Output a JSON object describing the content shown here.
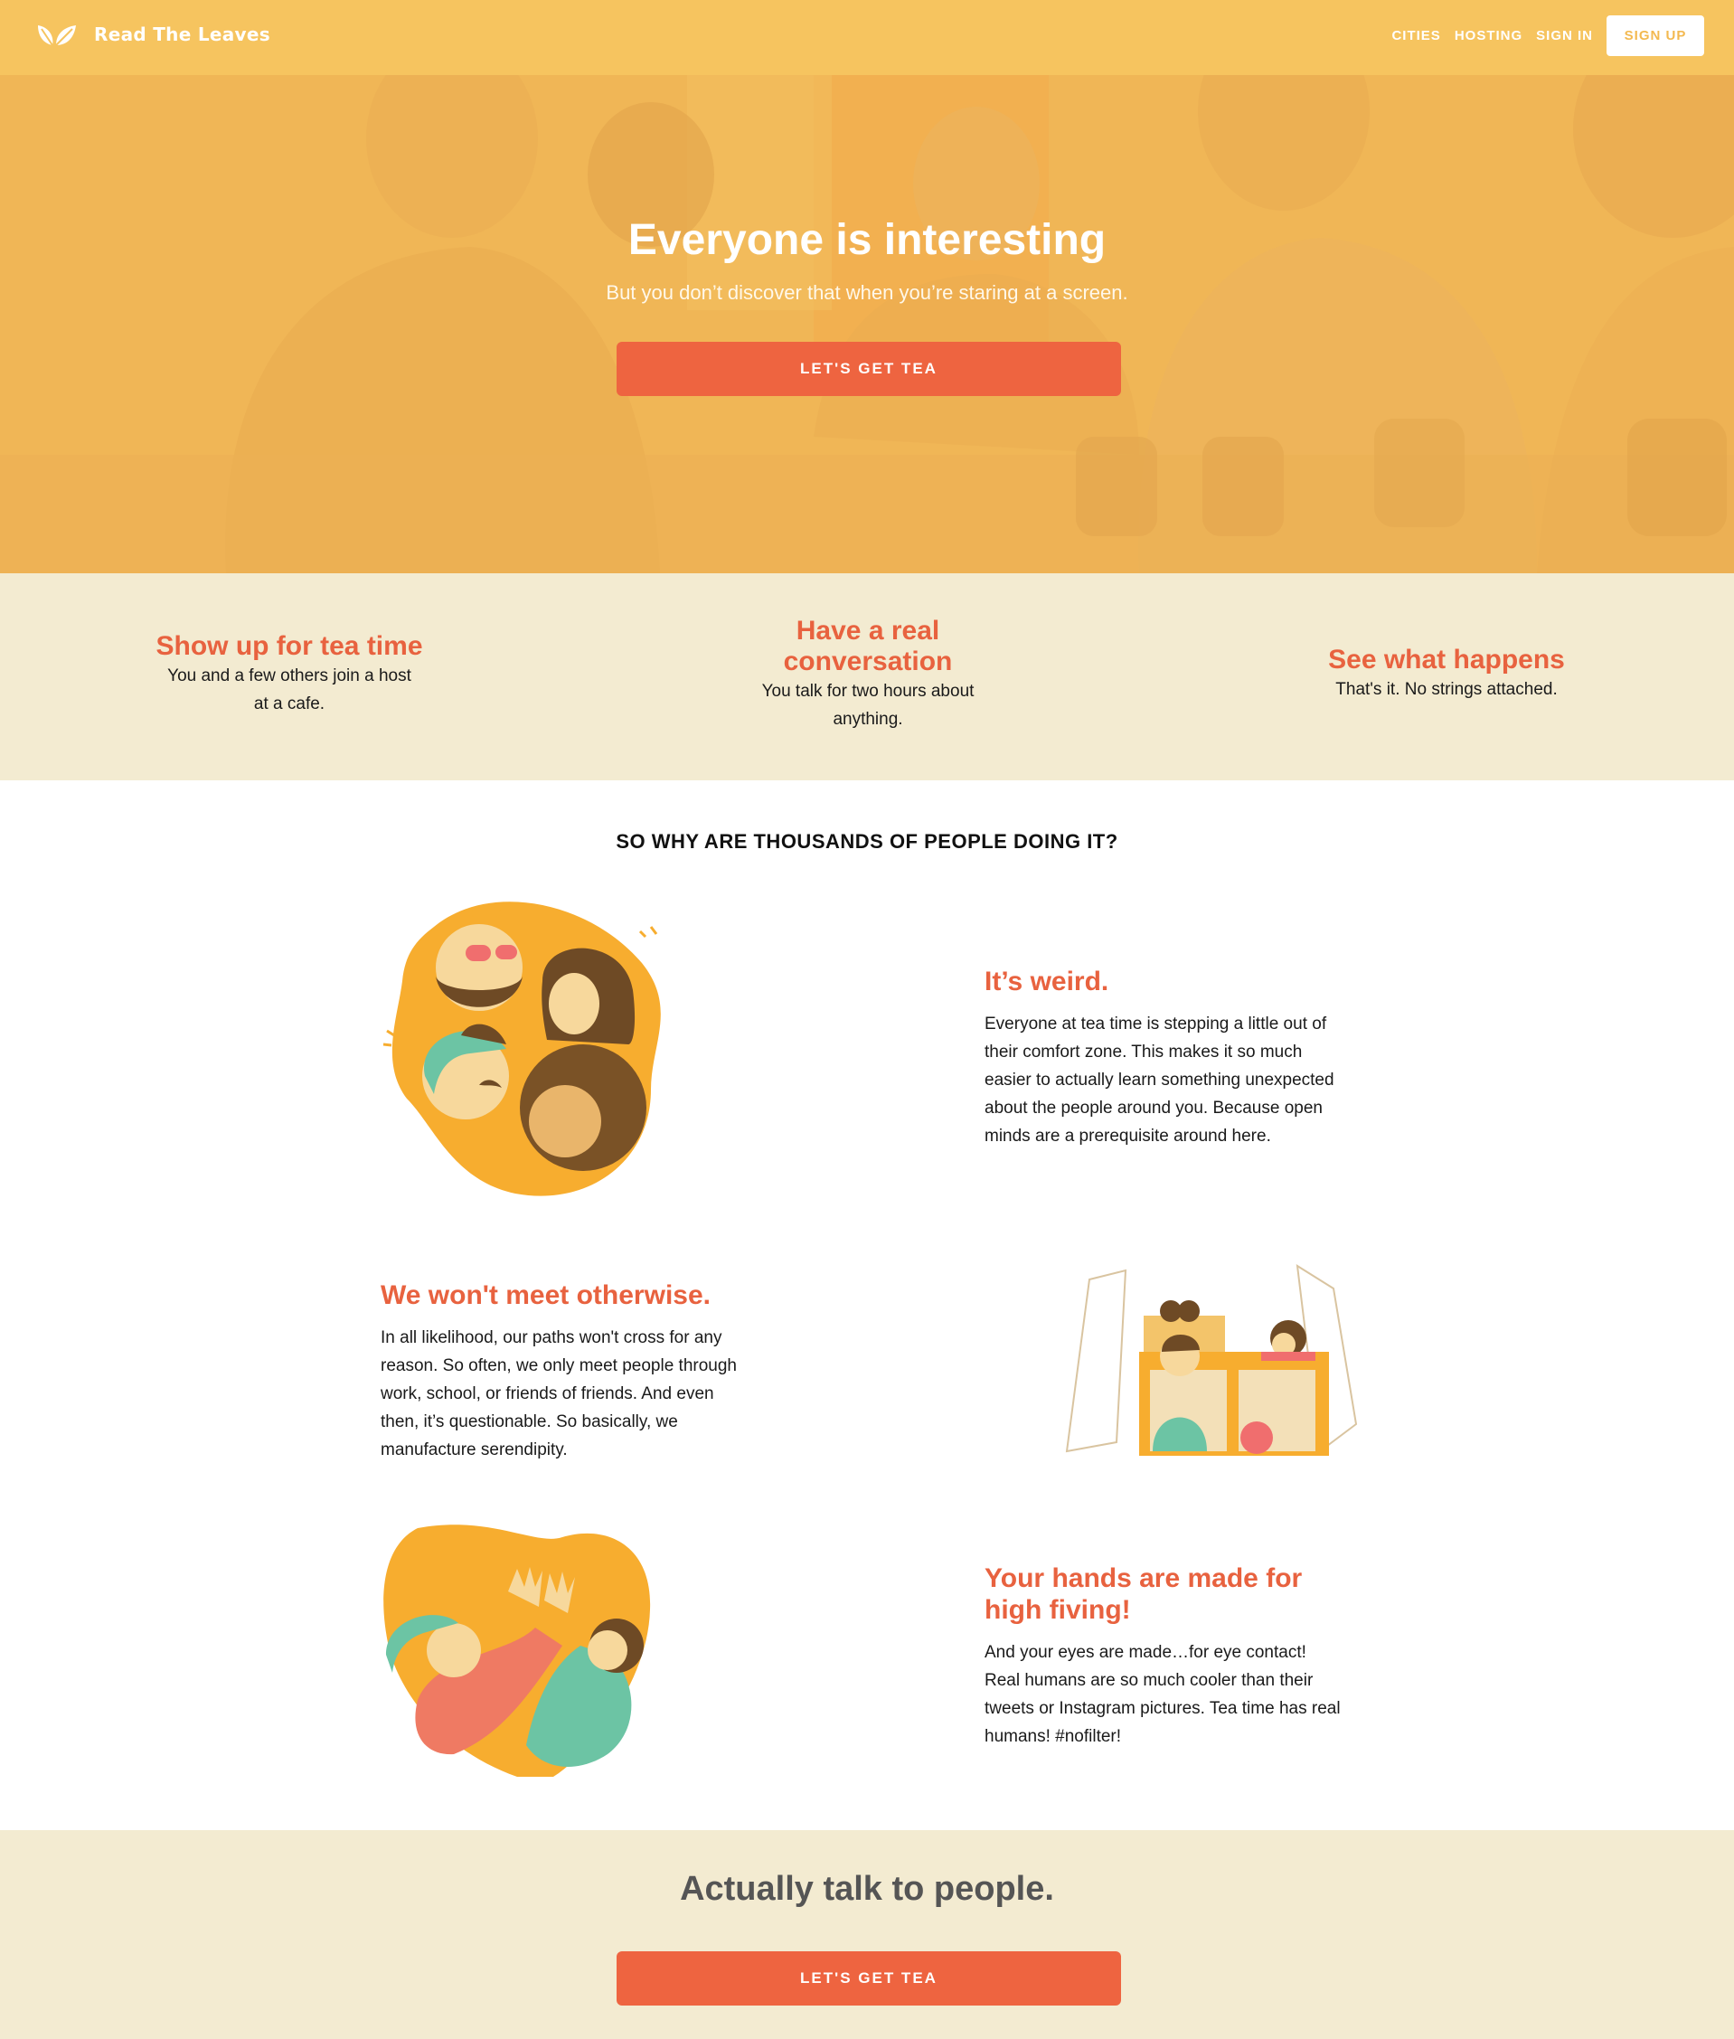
{
  "nav": {
    "brand": "Read The Leaves",
    "links": [
      "CITIES",
      "HOSTING",
      "SIGN IN"
    ],
    "signup_label": "SIGN UP"
  },
  "hero": {
    "title": "Everyone is interesting",
    "subtitle": "But you don’t discover that when you’re staring at a screen.",
    "cta_label": "LET'S GET TEA"
  },
  "steps": [
    {
      "title_lines": [
        "Show up for tea time"
      ],
      "text_lines": [
        "You and a few others join a host",
        "at a cafe."
      ]
    },
    {
      "title_lines": [
        "Have a real",
        "conversation"
      ],
      "text_lines": [
        "You talk for two hours about",
        "anything."
      ]
    },
    {
      "title_lines": [
        "See what happens"
      ],
      "text_lines": [
        "That's it. No strings attached."
      ]
    }
  ],
  "why": {
    "title": "SO WHY ARE THOUSANDS OF PEOPLE DOING IT?",
    "features": [
      {
        "title_lines": [
          "It’s weird."
        ],
        "text_lines": [
          "Everyone at tea time is stepping a little out of",
          "their comfort zone. This makes it so much",
          "easier to actually learn something unexpected",
          "about the people around you. Because open",
          "minds are a prerequisite around here."
        ]
      },
      {
        "title_lines": [
          "We won't meet otherwise."
        ],
        "text_lines": [
          "In all likelihood, our paths won't cross for any",
          "reason. So often, we only meet people through",
          "work, school, or friends of friends. And even",
          "then, it’s questionable. So basically, we",
          "manufacture serendipity."
        ]
      },
      {
        "title_lines": [
          "Your hands are made for",
          "high fiving!"
        ],
        "text_lines": [
          "And your eyes are made…for eye contact!",
          "Real humans are so much cooler than their",
          "tweets or Instagram pictures. Tea time has real",
          "humans! #nofilter!"
        ]
      }
    ]
  },
  "bottom": {
    "title": "Actually talk to people.",
    "cta_label": "LET'S GET TEA"
  },
  "colors": {
    "nav_bg": "#f6c45f",
    "accent": "#ee6440",
    "heading_accent": "#e8623f",
    "cream": "#f3ebd1",
    "illustration_orange": "#f7ad2f",
    "illustration_teal": "#6cc4a4",
    "illustration_brown": "#6e4a25"
  },
  "icons": [
    "leaf-logo-icon"
  ]
}
